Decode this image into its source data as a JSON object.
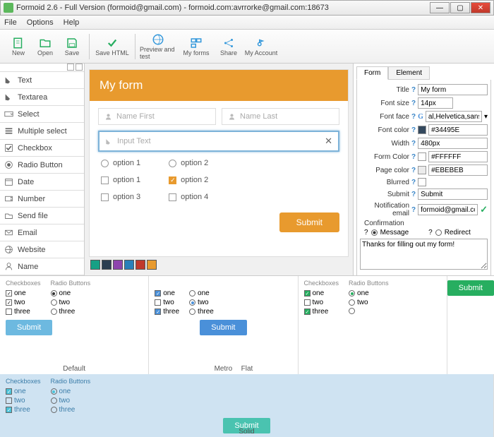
{
  "window": {
    "title": "Formoid 2.6 - Full Version (formoid@gmail.com) - formoid.com:avrrorke@gmail.com:18673"
  },
  "menu": {
    "file": "File",
    "options": "Options",
    "help": "Help"
  },
  "toolbar": {
    "new": "New",
    "open": "Open",
    "save": "Save",
    "savehtml": "Save HTML",
    "preview": "Preview and test",
    "myforms": "My forms",
    "share": "Share",
    "account": "My Account"
  },
  "widgets": [
    "Text",
    "Textarea",
    "Select",
    "Multiple select",
    "Checkbox",
    "Radio Button",
    "Date",
    "Number",
    "Send file",
    "Email",
    "Website",
    "Name"
  ],
  "form": {
    "title": "My form",
    "firstname_ph": "Name First",
    "lastname_ph": "Name Last",
    "input_ph": "Input Text",
    "radio1": "option 1",
    "radio2": "option 2",
    "cb1": "option 1",
    "cb2": "option 2",
    "cb3": "option 3",
    "cb4": "option 4",
    "submit": "Submit"
  },
  "palette": [
    "#16a085",
    "#2c3e50",
    "#8e44ad",
    "#2980b9",
    "#c0392b",
    "#e89a2e"
  ],
  "proptabs": {
    "form": "Form",
    "element": "Element"
  },
  "props": {
    "title_l": "Title",
    "title_v": "My form",
    "fontsize_l": "Font size",
    "fontsize_v": "14px",
    "fontface_l": "Font face",
    "fontface_v": "al,Helvetica,sans-serif",
    "fontcolor_l": "Font color",
    "fontcolor_v": "#34495E",
    "width_l": "Width",
    "width_v": "480px",
    "formcolor_l": "Form Color",
    "formcolor_v": "#FFFFFF",
    "pagecolor_l": "Page color",
    "pagecolor_v": "#EBEBEB",
    "blurred_l": "Blurred",
    "submit_l": "Submit",
    "submit_v": "Submit",
    "notif_l": "Notification email",
    "notif_v": "formoid@gmail.com",
    "confirmation": "Confirmation",
    "msg": "Message",
    "redirect": "Redirect",
    "conftext": "Thanks for filling out my form!"
  },
  "themes": {
    "cb": "Checkboxes",
    "rb": "Radio Buttons",
    "one": "one",
    "two": "two",
    "three": "three",
    "submit": "Submit",
    "default": "Default",
    "metro": "Metro",
    "flat": "Flat",
    "solid": "Solid"
  }
}
